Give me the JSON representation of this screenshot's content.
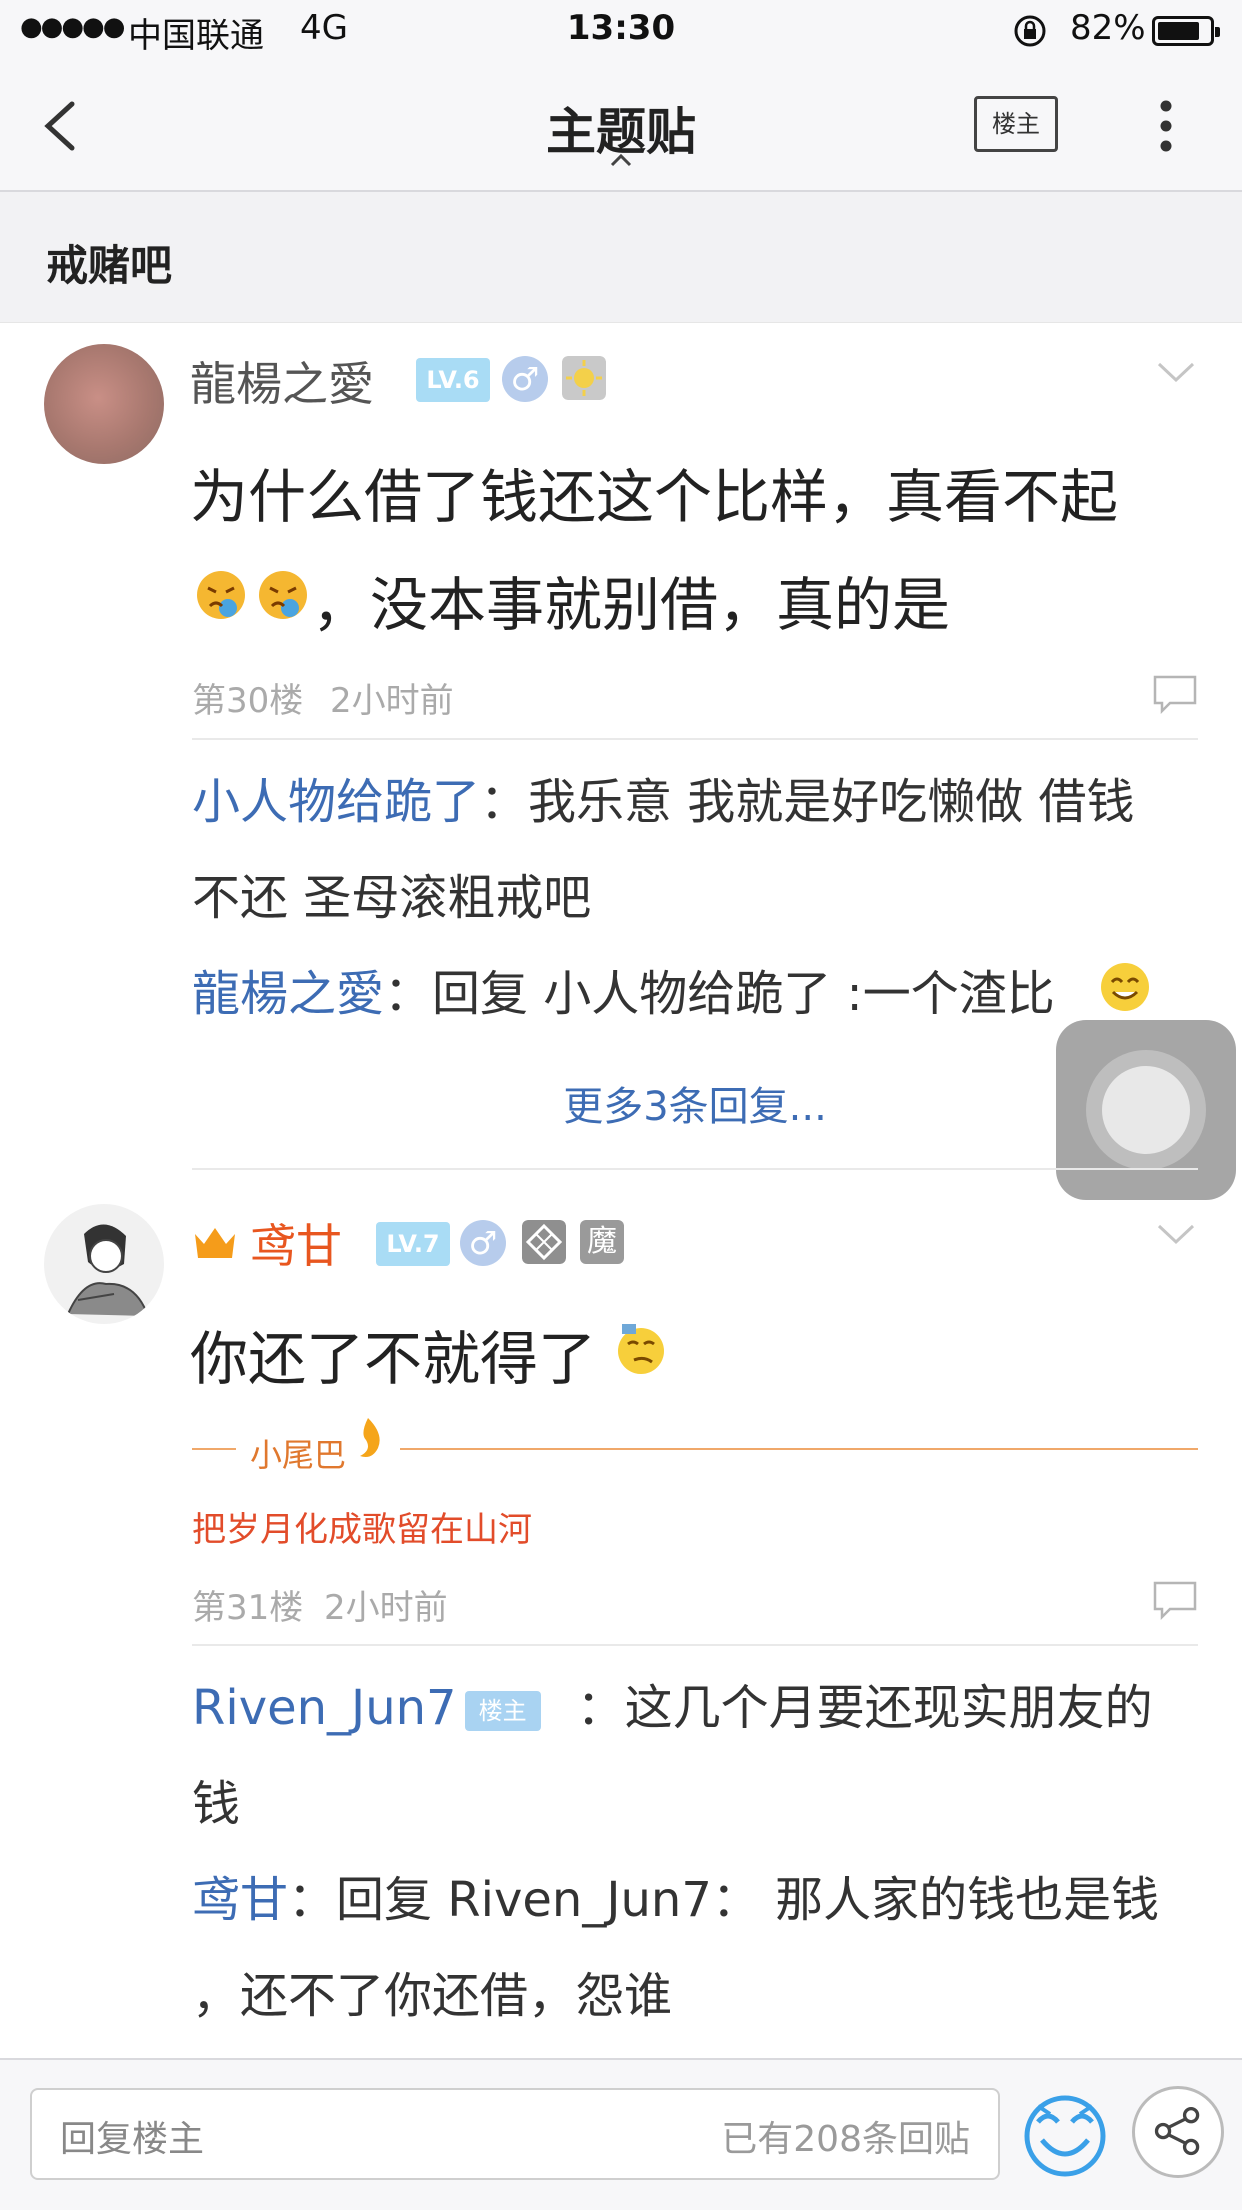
{
  "status_bar": {
    "signal": "●●●●●",
    "carrier": "中国联通",
    "network": "4G",
    "time": "13:30",
    "battery_percent": "82%",
    "battery_level": 0.82
  },
  "nav": {
    "title": "主题贴",
    "louzhu_label": "楼主"
  },
  "forum": {
    "name": "戒赌吧"
  },
  "posts": [
    {
      "username": "龍楊之愛",
      "level": "LV.6",
      "gender": "♂",
      "text_line1": "为什么借了钱还这个比样，真看不起",
      "text_line2": "，没本事就别借，真的是",
      "floor": "第30楼",
      "time": "2小时前",
      "replies": [
        {
          "name": "小人物给跪了",
          "sep": "：",
          "text1": "我乐意 我就是好吃懒做 借钱",
          "text2": "不还 圣母滚粗戒吧"
        },
        {
          "name": "龍楊之愛",
          "sep": "：",
          "text1": "回复 小人物给跪了 :一个渣比"
        }
      ],
      "more_replies": "更多3条回复..."
    },
    {
      "username": "鸢甘",
      "level": "LV.7",
      "gender": "♂",
      "badge_text": "魔",
      "text_line1": "你还了不就得了",
      "tail_label": "小尾巴",
      "tail_text": "把岁月化成歌留在山河",
      "floor": "第31楼",
      "time": "2小时前",
      "replies": [
        {
          "name": "Riven_Jun7",
          "tag": "楼主",
          "sep": "：",
          "text1": "这几个月要还现实朋友的",
          "text2": "钱"
        },
        {
          "name": "鸢甘",
          "sep": "：",
          "text1": "回复 Riven_Jun7： 那人家的钱也是钱",
          "text2": "，还不了你还借，怨谁"
        }
      ]
    }
  ],
  "bottom": {
    "placeholder": "回复楼主",
    "count_text": "已有208条回贴"
  },
  "colors": {
    "link_blue": "#3d6cb4",
    "tail_orange": "#e0782e",
    "tail_red": "#e24c2a",
    "level_badge": "#a9dcf5"
  }
}
